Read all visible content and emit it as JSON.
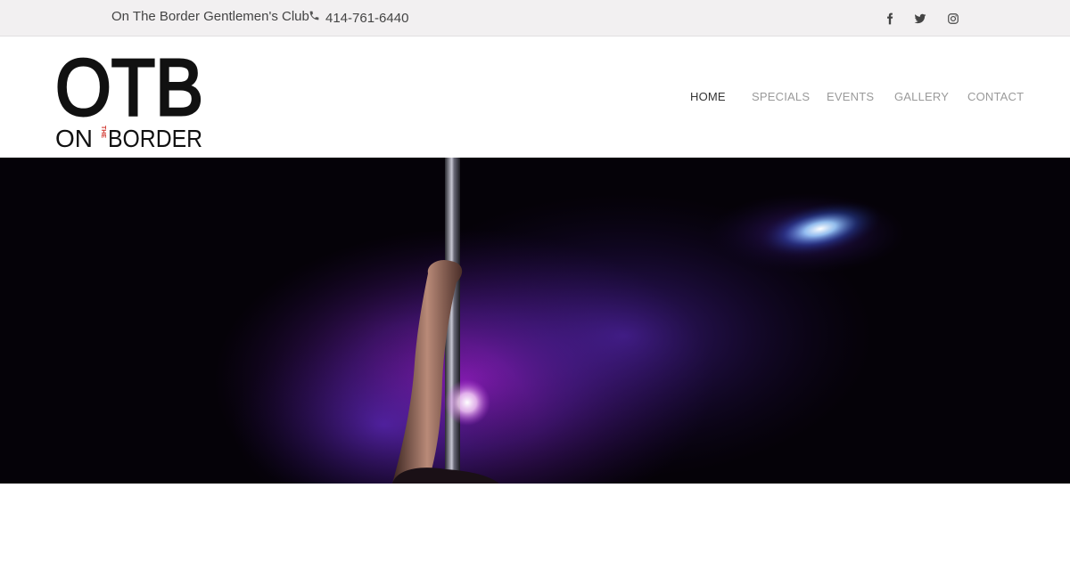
{
  "topbar": {
    "club_name": "On The Border Gentlemen's Club",
    "phone": "414-761-6440",
    "phone_icon": "phone-icon",
    "social_icons": [
      "facebook-icon",
      "twitter-icon",
      "instagram-icon"
    ]
  },
  "logo": {
    "big_text": "OTB",
    "left_text": "ON",
    "small_vertical": "THE",
    "right_text": "BORDER",
    "accent_color": "#d0342c"
  },
  "nav": {
    "items": [
      {
        "label": "HOME",
        "active": true
      },
      {
        "label": "SPECIALS",
        "active": false
      },
      {
        "label": "EVENTS",
        "active": false
      },
      {
        "label": "GALLERY",
        "active": false
      },
      {
        "label": "CONTACT",
        "active": false
      }
    ]
  },
  "hero": {
    "image": "pole-dancer-purple-smoke-photo",
    "colors": {
      "smoke": "#8a2be2",
      "spotlight": "#7fb0ff",
      "background": "#050208"
    }
  }
}
